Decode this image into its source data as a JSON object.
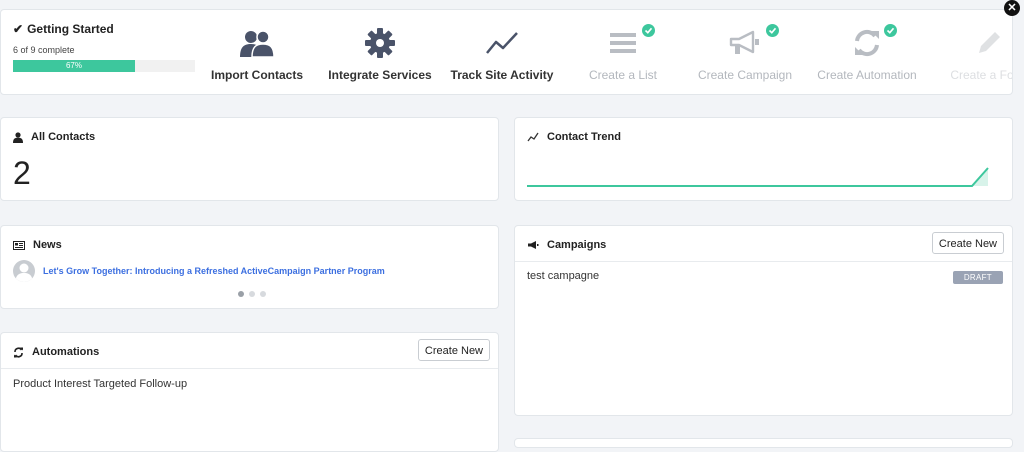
{
  "getting_started": {
    "title": "Getting Started",
    "progress_text": "6 of 9 complete",
    "progress_percent": 67,
    "progress_label": "67%",
    "steps": [
      {
        "label": "Import Contacts",
        "icon": "users-icon",
        "done": false
      },
      {
        "label": "Integrate Services",
        "icon": "gear-icon",
        "done": false
      },
      {
        "label": "Track Site Activity",
        "icon": "trend-icon",
        "done": false
      },
      {
        "label": "Create a List",
        "icon": "list-icon",
        "done": true
      },
      {
        "label": "Create Campaign",
        "icon": "megaphone-icon",
        "done": true
      },
      {
        "label": "Create Automation",
        "icon": "refresh-icon",
        "done": true
      },
      {
        "label": "Create a Form",
        "icon": "pencil-icon",
        "done": true
      }
    ],
    "accent_color": "#3dc79d"
  },
  "all_contacts": {
    "title": "All Contacts",
    "count": "2"
  },
  "contact_trend": {
    "title": "Contact Trend"
  },
  "news": {
    "title": "News",
    "item": "Let's Grow Together: Introducing a Refreshed ActiveCampaign Partner Program",
    "page_dots": 3,
    "active_dot": 0
  },
  "campaigns": {
    "title": "Campaigns",
    "create_label": "Create New",
    "items": [
      {
        "name": "test campagne",
        "status": "DRAFT"
      }
    ]
  },
  "automations": {
    "title": "Automations",
    "create_label": "Create New",
    "items": [
      {
        "name": "Product Interest Targeted Follow-up"
      }
    ]
  }
}
